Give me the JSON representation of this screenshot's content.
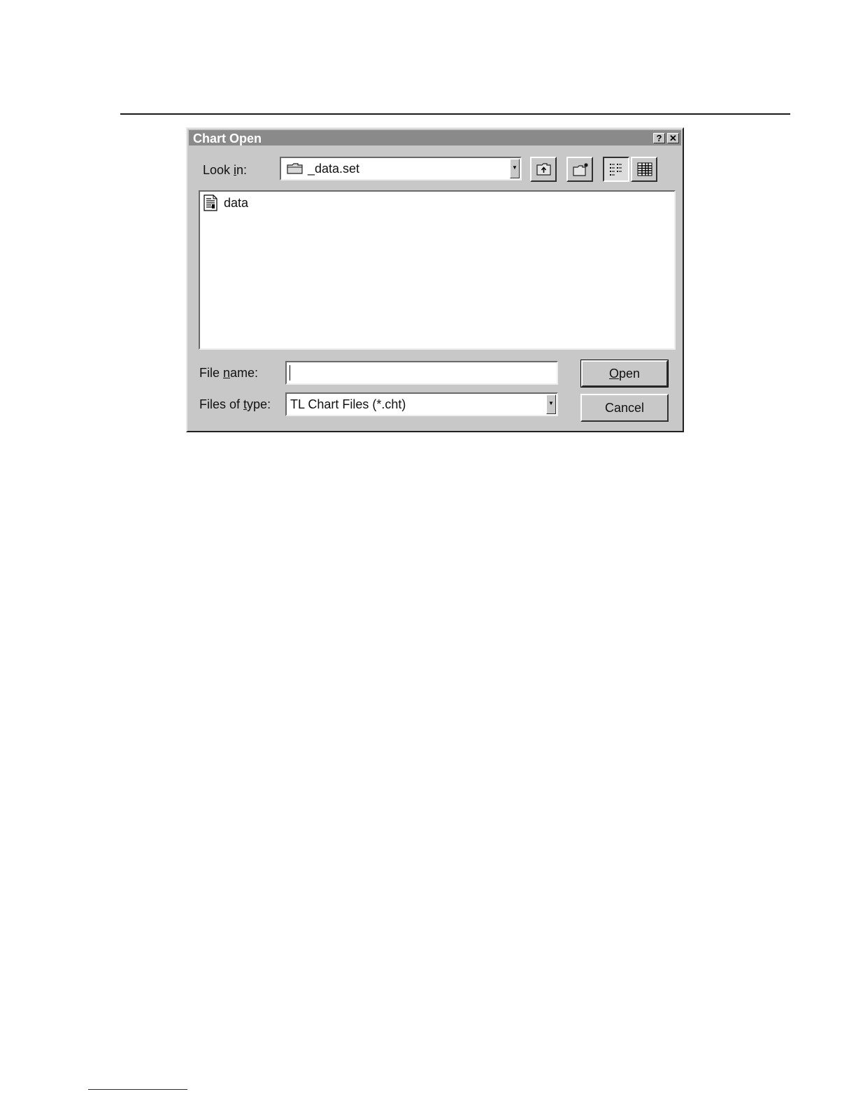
{
  "dialog": {
    "title": "Chart Open",
    "help_label": "?",
    "close_label": "✕"
  },
  "look_in": {
    "label_pre": "Look ",
    "label_mnemonic": "i",
    "label_post": "n:",
    "value": "_data.set"
  },
  "toolbar": {
    "icons": [
      "up-folder-icon",
      "new-folder-icon",
      "list-view-icon",
      "details-view-icon"
    ]
  },
  "file_list": {
    "items": [
      {
        "label": "data",
        "icon": "chart-file-icon"
      }
    ]
  },
  "file_name": {
    "label_pre": "File ",
    "label_mnemonic": "n",
    "label_post": "ame:",
    "value": ""
  },
  "file_type": {
    "label_pre": "Files of ",
    "label_mnemonic": "t",
    "label_post": "ype:",
    "value": "TL Chart Files (*.cht)"
  },
  "buttons": {
    "open_mnemonic": "O",
    "open_rest": "pen",
    "cancel": "Cancel"
  }
}
